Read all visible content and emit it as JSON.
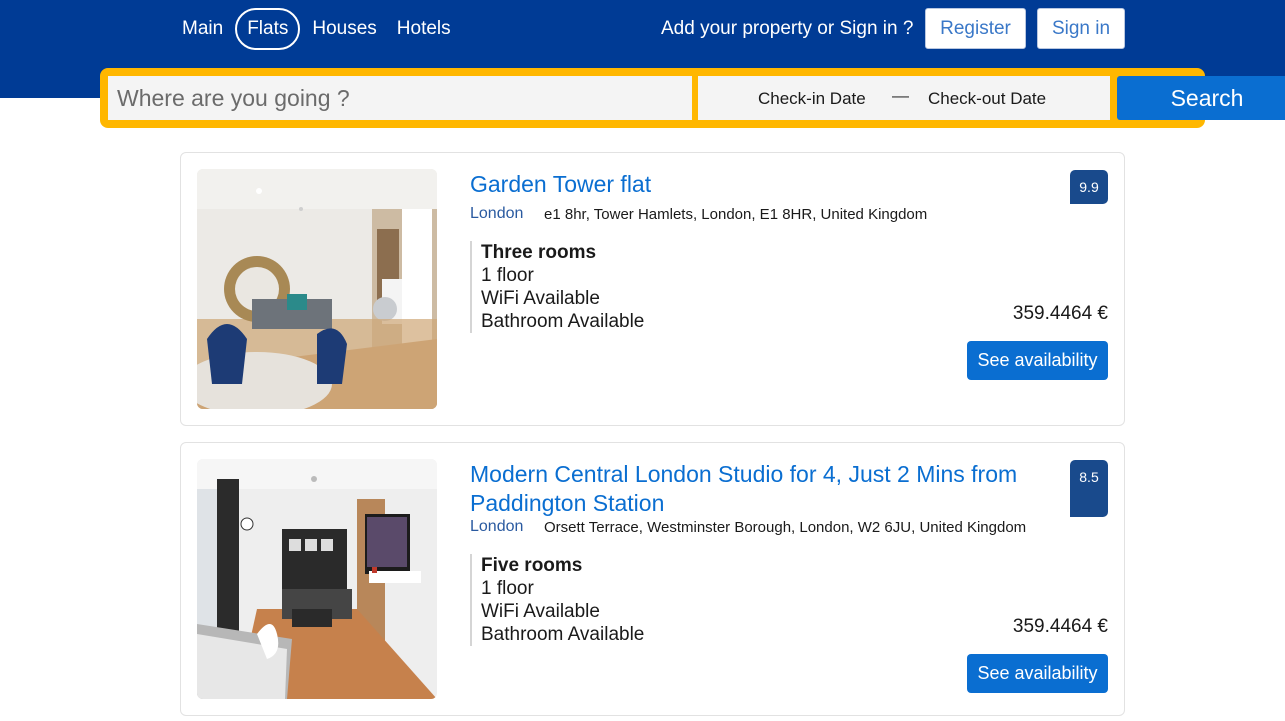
{
  "nav": {
    "items": [
      {
        "label": "Main",
        "active": false
      },
      {
        "label": "Flats",
        "active": true
      },
      {
        "label": "Houses",
        "active": false
      },
      {
        "label": "Hotels",
        "active": false
      }
    ],
    "auth_text": "Add your property or Sign in ?",
    "register_label": "Register",
    "signin_label": "Sign in"
  },
  "search": {
    "placeholder": "Where are you going ?",
    "checkin_label": "Check-in Date",
    "separator": "—",
    "checkout_label": "Check-out Date",
    "button_label": "Search"
  },
  "listings": [
    {
      "title": "Garden Tower flat",
      "city": "London",
      "address": "e1 8hr, Tower Hamlets, London, E1 8HR, United Kingdom",
      "features": [
        "Three rooms",
        "1 floor",
        "WiFi Available",
        "Bathroom Available"
      ],
      "rating": "9.9",
      "price": "359.4464 €",
      "button_label": "See availability"
    },
    {
      "title": "Modern Central London Studio for 4, Just 2 Mins from Paddington Station",
      "city": "London",
      "address": "Orsett Terrace, Westminster Borough, London, W2 6JU, United Kingdom",
      "features": [
        "Five rooms",
        "1 floor",
        "WiFi Available",
        "Bathroom Available"
      ],
      "rating": "8.5",
      "price": "359.4464 €",
      "button_label": "See availability"
    }
  ],
  "colors": {
    "header_bg": "#003b95",
    "search_frame": "#ffb700",
    "primary": "#0a6ed1",
    "rating_bg": "#194a8c"
  }
}
